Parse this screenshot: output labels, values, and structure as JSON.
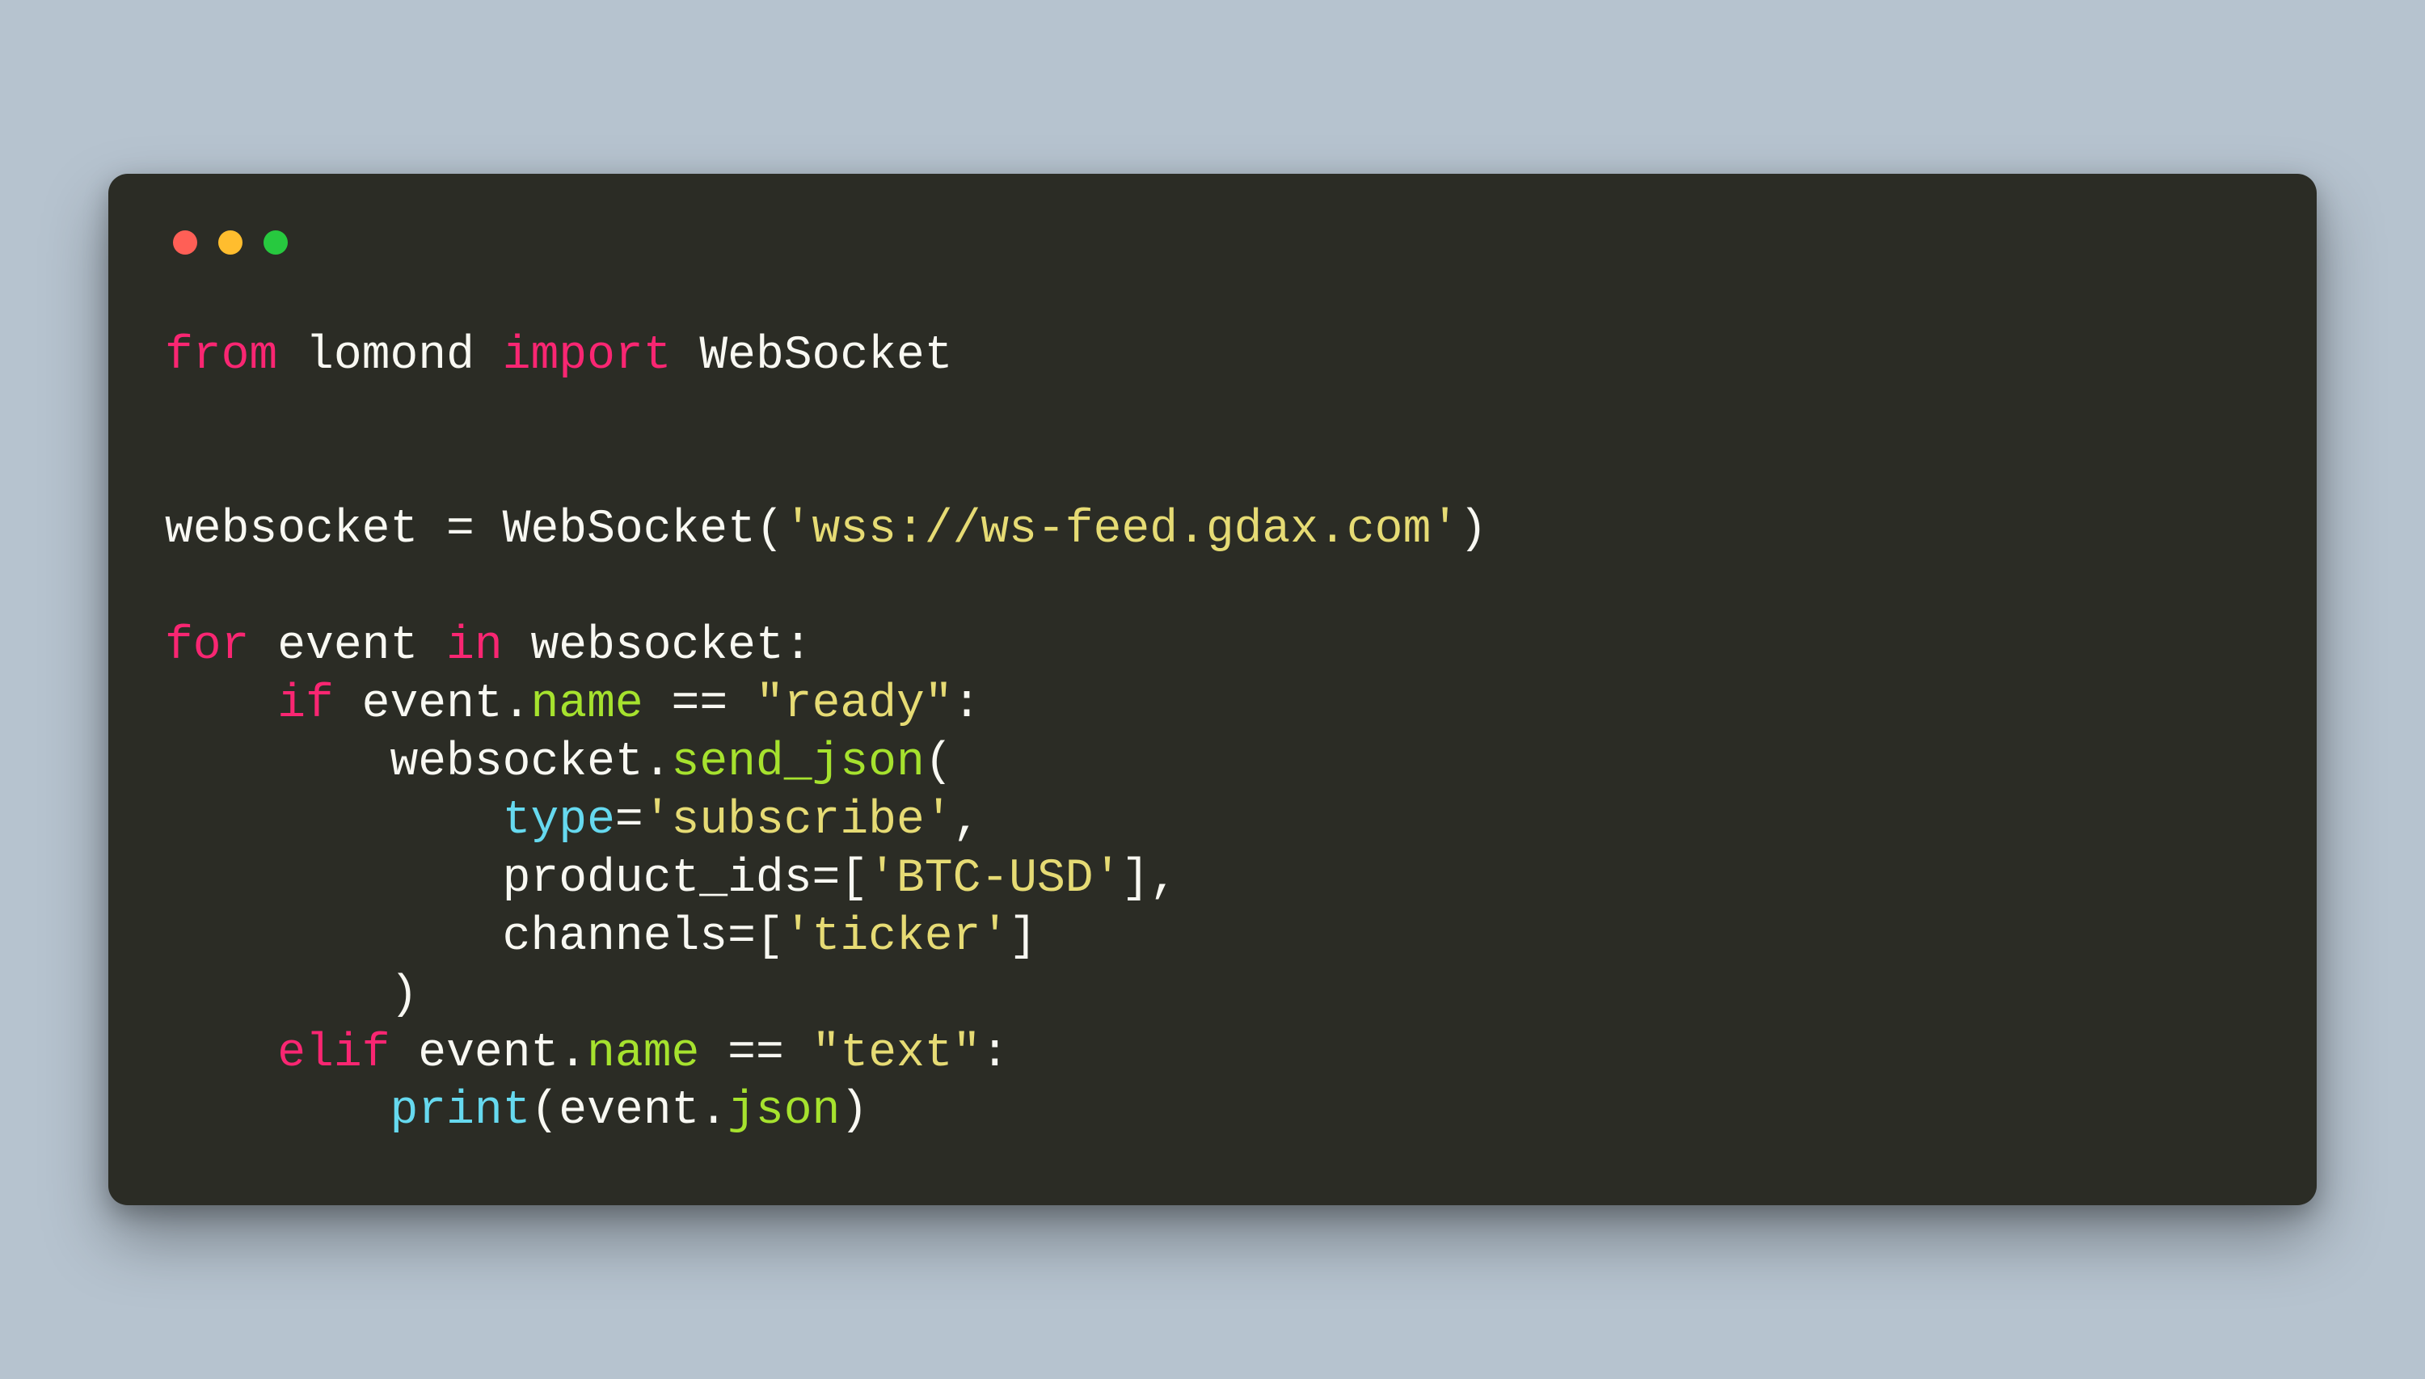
{
  "colors": {
    "background_page": "#b6c3cf",
    "window_bg": "#2b2c25",
    "dot_red": "#ff5f56",
    "dot_yellow": "#ffbd2e",
    "dot_green": "#27c93f",
    "text_default": "#f8f8f2",
    "keyword": "#f92672",
    "builtin": "#66d9ef",
    "attribute": "#a6e22e",
    "string": "#e6db74"
  },
  "code": {
    "tokens": [
      {
        "t": "from",
        "c": "kw"
      },
      {
        "t": " lomond ",
        "c": ""
      },
      {
        "t": "import",
        "c": "kw"
      },
      {
        "t": " WebSocket",
        "c": ""
      },
      {
        "t": "\n",
        "c": ""
      },
      {
        "t": "\n",
        "c": ""
      },
      {
        "t": "\n",
        "c": ""
      },
      {
        "t": "websocket = WebSocket(",
        "c": ""
      },
      {
        "t": "'wss://ws-feed.gdax.com'",
        "c": "str"
      },
      {
        "t": ")",
        "c": ""
      },
      {
        "t": "\n",
        "c": ""
      },
      {
        "t": "\n",
        "c": ""
      },
      {
        "t": "for",
        "c": "kw"
      },
      {
        "t": " event ",
        "c": ""
      },
      {
        "t": "in",
        "c": "kw"
      },
      {
        "t": " websocket:",
        "c": ""
      },
      {
        "t": "\n",
        "c": ""
      },
      {
        "t": "    ",
        "c": ""
      },
      {
        "t": "if",
        "c": "kw"
      },
      {
        "t": " event.",
        "c": ""
      },
      {
        "t": "name",
        "c": "attr"
      },
      {
        "t": " == ",
        "c": ""
      },
      {
        "t": "\"ready\"",
        "c": "str"
      },
      {
        "t": ":",
        "c": ""
      },
      {
        "t": "\n",
        "c": ""
      },
      {
        "t": "        websocket.",
        "c": ""
      },
      {
        "t": "send_json",
        "c": "attr"
      },
      {
        "t": "(",
        "c": ""
      },
      {
        "t": "\n",
        "c": ""
      },
      {
        "t": "            ",
        "c": ""
      },
      {
        "t": "type",
        "c": "fn"
      },
      {
        "t": "=",
        "c": ""
      },
      {
        "t": "'subscribe'",
        "c": "str"
      },
      {
        "t": ",",
        "c": ""
      },
      {
        "t": "\n",
        "c": ""
      },
      {
        "t": "            product_ids=[",
        "c": ""
      },
      {
        "t": "'BTC-USD'",
        "c": "str"
      },
      {
        "t": "],",
        "c": ""
      },
      {
        "t": "\n",
        "c": ""
      },
      {
        "t": "            channels=[",
        "c": ""
      },
      {
        "t": "'ticker'",
        "c": "str"
      },
      {
        "t": "]",
        "c": ""
      },
      {
        "t": "\n",
        "c": ""
      },
      {
        "t": "        )",
        "c": ""
      },
      {
        "t": "\n",
        "c": ""
      },
      {
        "t": "    ",
        "c": ""
      },
      {
        "t": "elif",
        "c": "kw"
      },
      {
        "t": " event.",
        "c": ""
      },
      {
        "t": "name",
        "c": "attr"
      },
      {
        "t": " == ",
        "c": ""
      },
      {
        "t": "\"text\"",
        "c": "str"
      },
      {
        "t": ":",
        "c": ""
      },
      {
        "t": "\n",
        "c": ""
      },
      {
        "t": "        ",
        "c": ""
      },
      {
        "t": "print",
        "c": "fn"
      },
      {
        "t": "(event.",
        "c": ""
      },
      {
        "t": "json",
        "c": "attr"
      },
      {
        "t": ")",
        "c": ""
      }
    ],
    "plain": "from lomond import WebSocket\n\n\nwebsocket = WebSocket('wss://ws-feed.gdax.com')\n\nfor event in websocket:\n    if event.name == \"ready\":\n        websocket.send_json(\n            type='subscribe',\n            product_ids=['BTC-USD'],\n            channels=['ticker']\n        )\n    elif event.name == \"text\":\n        print(event.json)"
  }
}
